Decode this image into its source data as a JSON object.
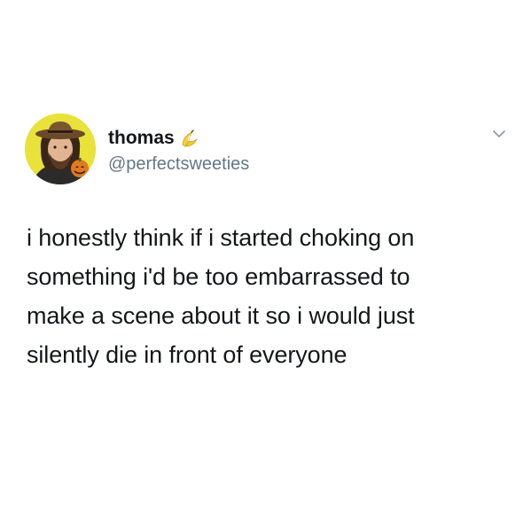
{
  "tweet": {
    "author": {
      "display_name": "thomas",
      "name_emoji": "banana-emoji",
      "handle": "@perfectsweeties",
      "avatar": "avatar"
    },
    "menu_icon": "chevron-down-icon",
    "text_lines": [
      "i honestly think if i started choking on",
      "something i'd be too embarrassed to",
      "make a scene about it so i would just",
      "silently die in front of everyone"
    ]
  },
  "colors": {
    "text": "#14171a",
    "handle": "#657786",
    "caret": "#8899a6",
    "avatar_background": "#e8e23a"
  }
}
